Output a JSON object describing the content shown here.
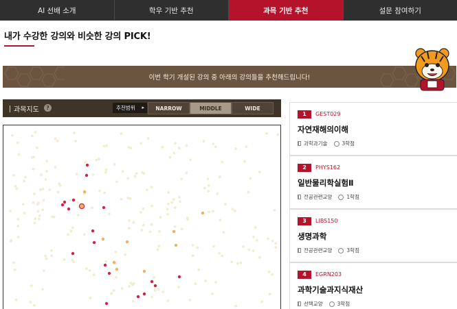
{
  "nav": {
    "tabs": [
      {
        "label": "AI 선배 소개"
      },
      {
        "label": "학우 기반 추천"
      },
      {
        "label": "과목 기반 추천"
      },
      {
        "label": "설문 참여하기"
      }
    ],
    "active_index": 2
  },
  "headline": "내가 수강한 강의와 비슷한 강의 PICK!",
  "banner": {
    "text": "이번 학기 개설된 강의 중 아래의 강의들을 추천해드립니다!"
  },
  "map": {
    "title": "과목지도",
    "help": "?",
    "range_label": "추천범위",
    "range_arrow": "▸",
    "modes": [
      "NARROW",
      "MIDDLE",
      "WIDE"
    ],
    "active_mode": "MIDDLE"
  },
  "recommendations": [
    {
      "rank": "1",
      "code": "GEST029",
      "name": "자연재해의이해",
      "category": "과학과기술",
      "credits": "3학점"
    },
    {
      "rank": "2",
      "code": "PHYS162",
      "name": "일반물리학실험Ⅱ",
      "category": "전공관련교양",
      "credits": "1학점"
    },
    {
      "rank": "3",
      "code": "LIBS150",
      "name": "생명과학",
      "category": "전공관련교양",
      "credits": "3학점"
    },
    {
      "rank": "4",
      "code": "EGRN203",
      "name": "과학기술과지식재산",
      "category": "선택교양",
      "credits": "3학점"
    }
  ],
  "colors": {
    "accent": "#b5122b",
    "nav_bg": "#2f2f2f",
    "banner_bg": "#6b5540",
    "map_header_bg": "#3e3428",
    "dot_faint": "#f3ecd0",
    "dot_orange": "#f0b060",
    "dot_red": "#d41f48"
  }
}
